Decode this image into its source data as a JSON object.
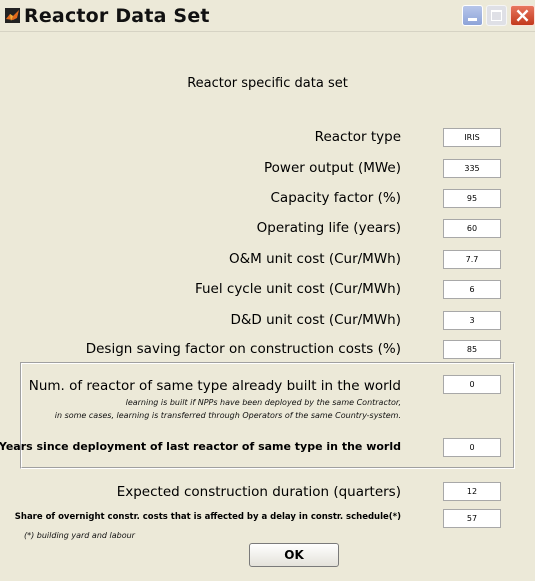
{
  "window": {
    "title": "Reactor Data Set",
    "icon": "matlab-icon"
  },
  "heading": "Reactor specific data set",
  "rows": [
    {
      "label": "Reactor type",
      "value": "IRIS"
    },
    {
      "label": "Power output (MWe)",
      "value": "335"
    },
    {
      "label": "Capacity factor (%)",
      "value": "95"
    },
    {
      "label": "Operating life (years)",
      "value": "60"
    },
    {
      "label": "O&M unit cost (Cur/MWh)",
      "value": "7.7"
    },
    {
      "label": "Fuel cycle unit cost (Cur/MWh)",
      "value": "6"
    },
    {
      "label": "D&D unit cost (Cur/MWh)",
      "value": "3"
    },
    {
      "label": "Design saving factor on construction costs (%)",
      "value": "85"
    }
  ],
  "learning": {
    "label": "Num. of reactor of same type already built in the world",
    "value": "0",
    "note_line1": "learning is built if NPPs have been deployed by the same Contractor,",
    "note_line2": "in some cases, learning is transferred through Operators of the same Country-system.",
    "years_label": "Years since deployment of last reactor of same type in the world",
    "years_value": "0"
  },
  "construction": {
    "duration_label": "Expected construction duration (quarters)",
    "duration_value": "12",
    "share_label": "Share of overnight constr. costs that is affected by a delay in constr. schedule(*)",
    "share_value": "57",
    "footnote": "(*) building yard and labour"
  },
  "ok_label": "OK"
}
